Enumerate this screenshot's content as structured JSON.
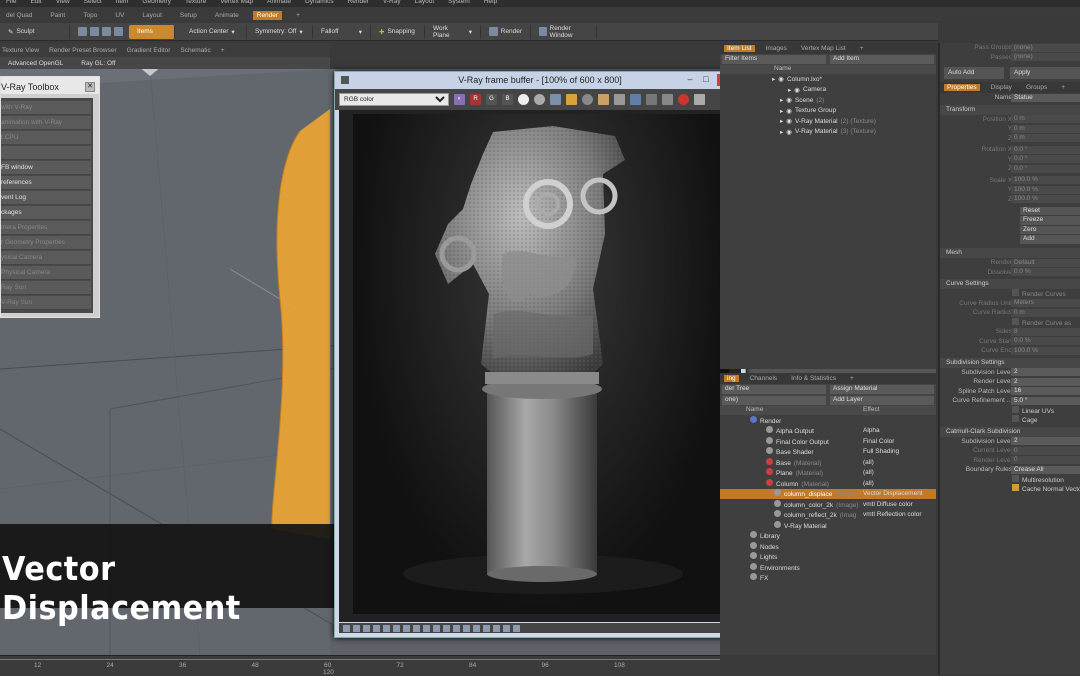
{
  "menubar": [
    "File",
    "Edit",
    "View",
    "Select",
    "Item",
    "Geometry",
    "Texture",
    "Vertex Map",
    "Animate",
    "Dynamics",
    "Render",
    "V-Ray",
    "Layout",
    "System",
    "Help"
  ],
  "tabs": {
    "items": [
      "del Quad",
      "Paint",
      "Topo",
      "UV",
      "Layout",
      "Setup",
      "Animate",
      "Render",
      "+"
    ],
    "active": "Render"
  },
  "toolbar": {
    "sculpt": "Sculpt",
    "items": "Items",
    "action_center": "Action Center",
    "symmetry": "Symmetry: Off",
    "falloff": "Falloff",
    "snapping": "Snapping",
    "work_plane": "Work Plane",
    "render": "Render",
    "render_window": "Render Window"
  },
  "viewport_tabs": [
    "Texture View",
    "Render Preset Browser",
    "Gradient Editor",
    "Schematic",
    "+"
  ],
  "viewport_options": {
    "advanced_opengl": "Advanced OpenGL",
    "ray_gl": "Ray GL: Off"
  },
  "toolbox": {
    "title": "V-Ray Toolbox",
    "items": [
      {
        "label": "with V-Ray",
        "enabled": false
      },
      {
        "label": "animation with V-Ray",
        "enabled": false
      },
      {
        "label": "t CPU",
        "enabled": false
      },
      {
        "label": "",
        "enabled": false
      },
      {
        "label": "FB window",
        "enabled": true
      },
      {
        "label": "references",
        "enabled": true
      },
      {
        "label": "vent Log",
        "enabled": true
      },
      {
        "label": "ckages",
        "enabled": true
      },
      {
        "label": "mera Properties",
        "enabled": false
      },
      {
        "label": "r Geometry Properties",
        "enabled": false
      },
      {
        "label": "ysical Camera",
        "enabled": false
      },
      {
        "label": "Physical Camera",
        "enabled": false
      },
      {
        "label": "Ray Sun",
        "enabled": false
      },
      {
        "label": "V-Ray Sun",
        "enabled": false
      }
    ]
  },
  "vfb": {
    "title": "V-Ray frame buffer - [100% of 600 x 800]",
    "channel": "RGB color",
    "channels": [
      "R",
      "G",
      "B"
    ],
    "minimize": "–",
    "maximize": "□",
    "close": "✕"
  },
  "caption": "Vector Displacement",
  "timeline": {
    "ticks": [
      "12",
      "24",
      "36",
      "48",
      "60",
      "72",
      "84",
      "96",
      "108"
    ],
    "sub": "120"
  },
  "item_list": {
    "tabs": [
      "Item List",
      "Images",
      "Vertex Map List",
      "+"
    ],
    "active_tab": "Item List",
    "filter": "Filter Items",
    "add_item": "Add Item",
    "header": "Name",
    "items": [
      {
        "label": "Column.lxo*",
        "suffix": "",
        "indent": 0
      },
      {
        "label": "Camera",
        "suffix": "",
        "indent": 2
      },
      {
        "label": "Scene",
        "suffix": "(2)",
        "indent": 1
      },
      {
        "label": "Texture Group",
        "suffix": "",
        "indent": 1
      },
      {
        "label": "V-Ray Material",
        "suffix": "(2) (Texture)",
        "indent": 1
      },
      {
        "label": "V-Ray Material",
        "suffix": "(3) (Texture)",
        "indent": 1
      }
    ]
  },
  "shader": {
    "tabs": [
      "ing",
      "Channels",
      "Info & Statistics",
      "+"
    ],
    "view": "der Tree",
    "assign": "Assign Material",
    "none": "one)",
    "add_layer": "Add Layer",
    "col_name": "Name",
    "col_effect": "Effect",
    "rows": [
      {
        "label": "Render",
        "suffix": "",
        "effect": "",
        "indent": 0,
        "sel": false
      },
      {
        "label": "Alpha Output",
        "suffix": "",
        "effect": "Alpha",
        "indent": 2,
        "sel": false
      },
      {
        "label": "Final Color Output",
        "suffix": "",
        "effect": "Final Color",
        "indent": 2,
        "sel": false
      },
      {
        "label": "Base Shader",
        "suffix": "",
        "effect": "Full Shading",
        "indent": 2,
        "sel": false
      },
      {
        "label": "Base",
        "suffix": "(Material)",
        "effect": "(all)",
        "indent": 2,
        "sel": false
      },
      {
        "label": "Plane",
        "suffix": "(Material)",
        "effect": "(all)",
        "indent": 2,
        "sel": false
      },
      {
        "label": "Column",
        "suffix": "(Material)",
        "effect": "(all)",
        "indent": 2,
        "sel": false
      },
      {
        "label": "column_displace",
        "suffix": "(Image)",
        "effect": "Vector Displacement",
        "indent": 3,
        "sel": true
      },
      {
        "label": "column_color_2k",
        "suffix": "(Image)",
        "effect": "vmtl Diffuse color",
        "indent": 3,
        "sel": false
      },
      {
        "label": "column_reflect_2k",
        "suffix": "(Imag",
        "effect": "vmtl Reflection color",
        "indent": 3,
        "sel": false
      },
      {
        "label": "V-Ray Material",
        "suffix": "",
        "effect": "",
        "indent": 3,
        "sel": false
      },
      {
        "label": "Library",
        "suffix": "",
        "effect": "",
        "indent": 0,
        "sel": false
      },
      {
        "label": "Nodes",
        "suffix": "",
        "effect": "",
        "indent": 0,
        "sel": false
      },
      {
        "label": "Lights",
        "suffix": "",
        "effect": "",
        "indent": 0,
        "sel": false
      },
      {
        "label": "Environments",
        "suffix": "",
        "effect": "",
        "indent": 0,
        "sel": false
      },
      {
        "label": "FX",
        "suffix": "",
        "effect": "",
        "indent": 0,
        "sel": false
      }
    ]
  },
  "props": {
    "pass_groups": "Pass Groups",
    "passes": "Passes",
    "none": "(none)",
    "auto_add": "Auto Add",
    "apply": "Apply",
    "tabs": [
      "Properties",
      "Display",
      "Groups",
      "+"
    ],
    "active_tab": "Properties",
    "name_label": "Name",
    "name_value": "Statue",
    "transform": "Transform",
    "position": [
      {
        "l": "Position X",
        "v": "0 m"
      },
      {
        "l": "Y",
        "v": "0 m"
      },
      {
        "l": "Z",
        "v": "0 m"
      }
    ],
    "rotation": [
      {
        "l": "Rotation X",
        "v": "0.0 °"
      },
      {
        "l": "Y",
        "v": "0.0 °"
      },
      {
        "l": "Z",
        "v": "0.0 °"
      }
    ],
    "scale": [
      {
        "l": "Scale X",
        "v": "100.0 %"
      },
      {
        "l": "Y",
        "v": "100.0 %"
      },
      {
        "l": "Z",
        "v": "100.0 %"
      }
    ],
    "buttons": [
      "Reset",
      "Freeze",
      "Zero",
      "Add"
    ],
    "mesh": "Mesh",
    "render_l": "Render",
    "render_v": "Default",
    "dissolve_l": "Dissolve",
    "dissolve_v": "0.0 %",
    "curve_settings": "Curve Settings",
    "render_curves": "Render Curves",
    "curve_radius_unit": "Curve Radius Unit",
    "meters": "Meters",
    "curve_radius": "Curve Radius",
    "curve_radius_v": "0 m",
    "render_curve_as": "Render Curve as",
    "sides": "Sides",
    "sides_v": "8",
    "curve_start": "Curve Start",
    "curve_start_v": "0.0 %",
    "curve_end": "Curve End",
    "curve_end_v": "100.0 %",
    "subdivision_settings": "Subdivision Settings",
    "subdiv_level": "Subdivision Level",
    "subdiv_level_v": "2",
    "render_level": "Render Level",
    "render_level_v": "2",
    "spline_patch": "Spline Patch Level",
    "spline_patch_v": "16",
    "curve_refinement": "Curve Refinement ...",
    "curve_refinement_v": "5.0 °",
    "linear_uvs": "Linear UVs",
    "cage": "Cage",
    "catmull": "Catmull-Clark Subdivision",
    "cc_subdiv_level": "Subdivision Level",
    "cc_subdiv_level_v": "2",
    "current_level": "Current Level",
    "current_level_v": "0",
    "cc_render_level": "Render Level",
    "cc_render_level_v": "0",
    "boundary_rules": "Boundary Rules",
    "boundary_rules_v": "Crease All",
    "multiresolution": "Multiresolution",
    "cache_normal": "Cache Normal Vecto"
  },
  "accent_color": "#c07a28"
}
